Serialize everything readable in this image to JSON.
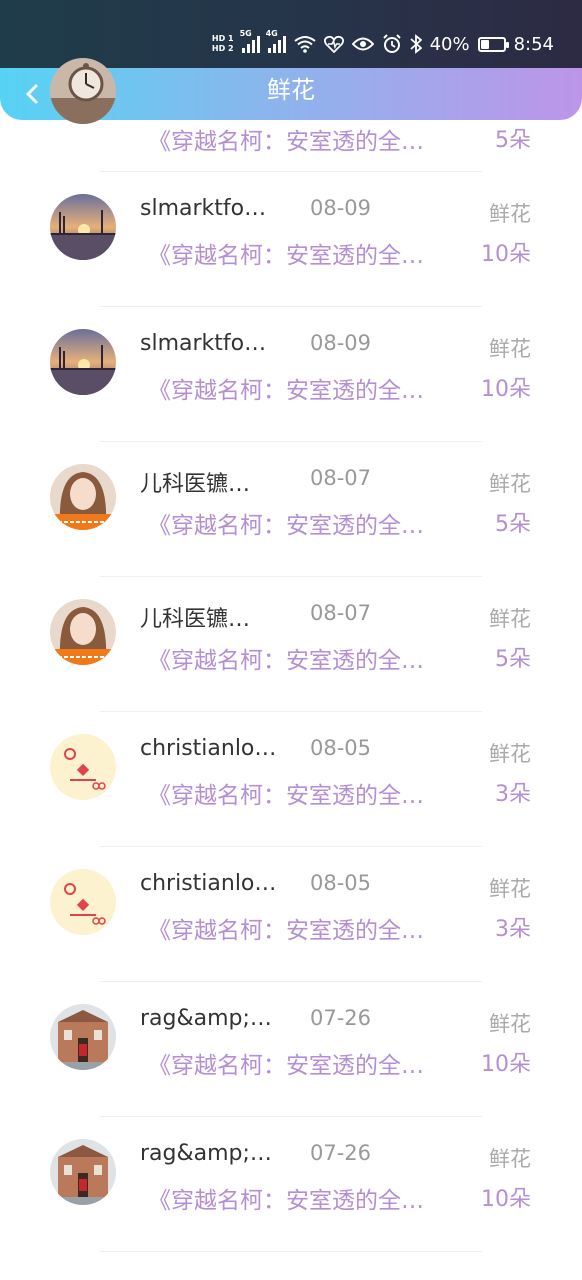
{
  "status_bar": {
    "hd1": "HD 1",
    "hd2": "HD 2",
    "sig1_label": "5G",
    "sig2_label": "4G",
    "battery_pct": "40%",
    "battery_level": 0.4,
    "time": "8:54"
  },
  "header": {
    "title": "鲜花",
    "back_icon": "chevron-left-icon"
  },
  "items": [
    {
      "name": "",
      "date": "",
      "type": "",
      "desc": "《穿越名柯：安室透的全…",
      "count": "5朵",
      "avatar": "clock"
    },
    {
      "name": "slmarktfo…",
      "date": "08-09",
      "type": "鲜花",
      "desc": "《穿越名柯：安室透的全…",
      "count": "10朵",
      "avatar": "sunset"
    },
    {
      "name": "slmarktfo…",
      "date": "08-09",
      "type": "鲜花",
      "desc": "《穿越名柯：安室透的全…",
      "count": "10朵",
      "avatar": "sunset"
    },
    {
      "name": "儿科医镳…",
      "date": "08-07",
      "type": "鲜花",
      "desc": "《穿越名柯：安室透的全…",
      "count": "5朵",
      "avatar": "girl"
    },
    {
      "name": "儿科医镳…",
      "date": "08-07",
      "type": "鲜花",
      "desc": "《穿越名柯：安室透的全…",
      "count": "5朵",
      "avatar": "girl"
    },
    {
      "name": "christianlo…",
      "date": "08-05",
      "type": "鲜花",
      "desc": "《穿越名柯：安室透的全…",
      "count": "3朵",
      "avatar": "cartoon"
    },
    {
      "name": "christianlo…",
      "date": "08-05",
      "type": "鲜花",
      "desc": "《穿越名柯：安室透的全…",
      "count": "3朵",
      "avatar": "cartoon"
    },
    {
      "name": "rag&amp;…",
      "date": "07-26",
      "type": "鲜花",
      "desc": "《穿越名柯：安室透的全…",
      "count": "10朵",
      "avatar": "building"
    },
    {
      "name": "rag&amp;…",
      "date": "07-26",
      "type": "鲜花",
      "desc": "《穿越名柯：安室透的全…",
      "count": "10朵",
      "avatar": "building"
    }
  ],
  "colors": {
    "accent_purple": "#b48fd4",
    "header_start": "#57d3f4",
    "header_end": "#bd95e8"
  }
}
